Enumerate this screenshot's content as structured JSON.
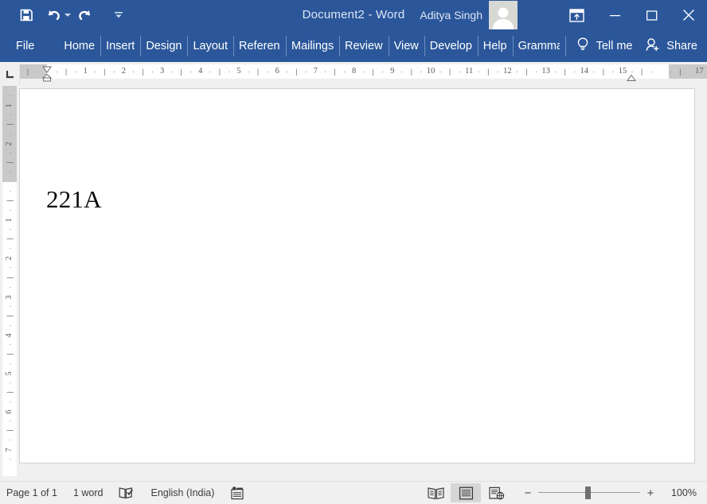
{
  "titlebar": {
    "document_title": "Document2  -  Word",
    "account_name": "Aditya Singh",
    "avatar_icon": "user-avatar-icon",
    "quick_access": [
      {
        "name": "save-icon",
        "label": "Save"
      },
      {
        "name": "undo-icon",
        "label": "Undo"
      },
      {
        "name": "redo-icon",
        "label": "Redo"
      },
      {
        "name": "customize-quick-access-toolbar-icon",
        "label": "Customize Quick Access Toolbar"
      }
    ],
    "window_controls": [
      {
        "name": "ribbon-display-options-icon",
        "label": "Ribbon Display Options"
      },
      {
        "name": "minimize-icon",
        "label": "Minimize"
      },
      {
        "name": "maximize-icon",
        "label": "Maximize"
      },
      {
        "name": "close-icon",
        "label": "Close"
      }
    ]
  },
  "ribbon": {
    "tabs": [
      {
        "key": "file",
        "label": "File"
      },
      {
        "key": "home",
        "label": "Home"
      },
      {
        "key": "insert",
        "label": "Insert"
      },
      {
        "key": "design",
        "label": "Design"
      },
      {
        "key": "layout",
        "label": "Layout"
      },
      {
        "key": "references",
        "label": "References"
      },
      {
        "key": "mailings",
        "label": "Mailings"
      },
      {
        "key": "review",
        "label": "Review"
      },
      {
        "key": "view",
        "label": "View"
      },
      {
        "key": "developer",
        "label": "Developer"
      },
      {
        "key": "help",
        "label": "Help"
      },
      {
        "key": "grammarly",
        "label": "Grammarly"
      }
    ],
    "tell_me": {
      "label": "Tell me",
      "icon": "lightbulb-icon"
    },
    "share": {
      "label": "Share",
      "icon": "share-person-icon"
    }
  },
  "ruler": {
    "tab_stop_selector_icon": "left-tab-stop-icon",
    "horizontal_labels": [
      "1",
      "2",
      "3",
      "4",
      "5",
      "6",
      "7",
      "8",
      "9",
      "10",
      "11",
      "12",
      "13",
      "14",
      "15",
      "17"
    ],
    "vertical_labels_margin": [
      "2",
      "1"
    ],
    "vertical_labels_page": [
      "1",
      "2",
      "3",
      "4",
      "5",
      "6",
      "7"
    ],
    "first_line_indent_icon": "first-line-indent-marker",
    "hanging_indent_icon": "hanging-indent-marker",
    "left_indent_icon": "left-indent-marker",
    "right_indent_icon": "right-indent-marker"
  },
  "document": {
    "text": "221A"
  },
  "statusbar": {
    "page_info": "Page 1 of 1",
    "word_count": "1 word",
    "proofing_icon": "proofing-errors-icon",
    "language": "English (India)",
    "macro_icon": "record-macro-icon",
    "views": [
      {
        "name": "read-mode-view-button",
        "label": "Read Mode",
        "selected": false
      },
      {
        "name": "print-layout-view-button",
        "label": "Print Layout",
        "selected": true
      },
      {
        "name": "web-layout-view-button",
        "label": "Web Layout",
        "selected": false
      }
    ],
    "zoom_out_label": "−",
    "zoom_in_label": "+",
    "zoom_level": "100%"
  },
  "colors": {
    "word_blue": "#2b579a",
    "chrome_gray": "#f0f0f0",
    "ruler_gray": "#c9c9c9",
    "page_white": "#ffffff"
  }
}
